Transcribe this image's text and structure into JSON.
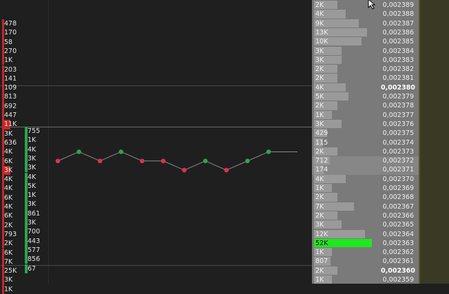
{
  "left_ask_column": {
    "values": [
      "478",
      "170",
      "58",
      "270",
      "1K",
      "203",
      "141",
      "109",
      "813",
      "692",
      "447",
      "11K",
      "3K",
      "636",
      "4K",
      "6K",
      "3K",
      "4K",
      "4K",
      "6K",
      "4K",
      "6K",
      "2K",
      "793",
      "2K",
      "6K",
      "7K",
      "25K",
      "3K",
      "1K"
    ],
    "emphasized_indices": [
      11,
      16
    ],
    "bar_color": "#c62828"
  },
  "left_bid_column": {
    "values": [
      "755",
      "1K",
      "4K",
      "3K",
      "3K",
      "4K",
      "5K",
      "1K",
      "3K",
      "861",
      "3K",
      "700",
      "443",
      "577",
      "856",
      "67"
    ],
    "bar_color": "#2da44e"
  },
  "center_chart": {
    "points": [
      {
        "value": "0,002372",
        "color": "#e03050"
      },
      {
        "value": "0,002373",
        "color": "#2da44e"
      },
      {
        "value": "0,002372",
        "color": "#e03050"
      },
      {
        "value": "0,002373",
        "color": "#2da44e"
      },
      {
        "value": "0,002372",
        "color": "#e03050"
      },
      {
        "value": "0,002372",
        "color": "#e03050"
      },
      {
        "value": "0,002371",
        "color": "#e03050"
      },
      {
        "value": "0,002372",
        "color": "#2da44e"
      },
      {
        "value": "0,002371",
        "color": "#e03050"
      },
      {
        "value": "0,002372",
        "color": "#2da44e"
      },
      {
        "value": "0,002373",
        "color": "#2da44e"
      }
    ]
  },
  "ladder": {
    "rows": [
      {
        "vol": "2K",
        "price": "0,002389"
      },
      {
        "vol": "4K",
        "price": "0,002388"
      },
      {
        "vol": "9K",
        "price": "0,002387"
      },
      {
        "vol": "13K",
        "price": "0,002386"
      },
      {
        "vol": "10K",
        "price": "0,002385"
      },
      {
        "vol": "3K",
        "price": "0,002384"
      },
      {
        "vol": "3K",
        "price": "0,002383"
      },
      {
        "vol": "2K",
        "price": "0,002382"
      },
      {
        "vol": "2K",
        "price": "0,002381"
      },
      {
        "vol": "4K",
        "price": "0,002380",
        "highlight": true
      },
      {
        "vol": "5K",
        "price": "0,002379"
      },
      {
        "vol": "2K",
        "price": "0,002378"
      },
      {
        "vol": "1K",
        "price": "0,002377"
      },
      {
        "vol": "3K",
        "price": "0,002376"
      },
      {
        "vol": "429",
        "price": "0,002375"
      },
      {
        "vol": "115",
        "price": "0,002374"
      },
      {
        "vol": "2K",
        "price": "0,002373"
      },
      {
        "vol": "712",
        "price": "0,002372"
      },
      {
        "vol": "174",
        "price": "0,002371"
      },
      {
        "vol": "4K",
        "price": "0,002370"
      },
      {
        "vol": "1K",
        "price": "0,002369"
      },
      {
        "vol": "2K",
        "price": "0,002368"
      },
      {
        "vol": "7K",
        "price": "0,002367"
      },
      {
        "vol": "2K",
        "price": "0,002366"
      },
      {
        "vol": "3K",
        "price": "0,002365"
      },
      {
        "vol": "12K",
        "price": "0,002364"
      },
      {
        "vol": "52K",
        "price": "0,002363",
        "big": true
      },
      {
        "vol": "1K",
        "price": "0,002362"
      },
      {
        "vol": "807",
        "price": "0,002361"
      },
      {
        "vol": "2K",
        "price": "0,002360",
        "highlight": true
      },
      {
        "vol": "1K",
        "price": "0,002359"
      }
    ],
    "big_bar_color": "#1ee81e"
  },
  "colors": {
    "background": "#1f1f1f",
    "ladder_bg": "#7a7a7a",
    "price_bg": "#787878",
    "right_pane": "#3a3a24",
    "ask_red": "#c62828",
    "bid_green": "#2da44e"
  }
}
